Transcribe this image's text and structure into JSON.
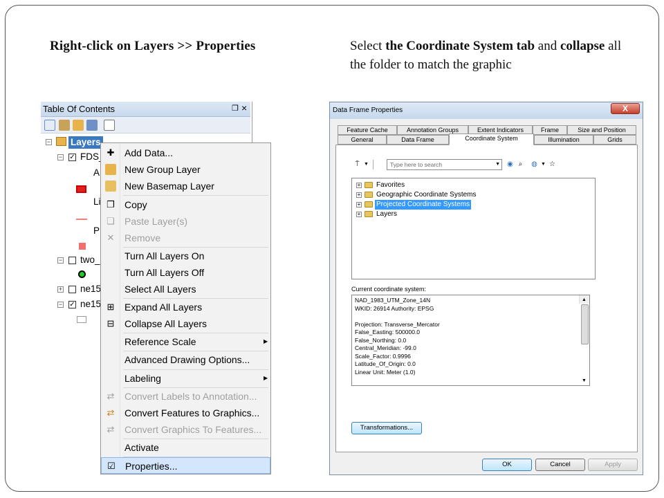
{
  "captions": {
    "left": "Right-click on Layers >> Properties",
    "right_parts": [
      "Select ",
      "the Coordinate System tab",
      " and ",
      "collapse",
      " all the folder to match the graphic"
    ]
  },
  "toc": {
    "title": "Table Of Contents",
    "pin": "❒",
    "close": "×",
    "tree": {
      "layers_label": "Layers",
      "row_fds": "FDS_",
      "row_a": "A",
      "row_li": "Li",
      "row_p": "P",
      "row_two": "two_",
      "row_ne1": "ne15",
      "row_ne2": "ne15"
    },
    "menu": [
      {
        "label": "Add Data...",
        "icon": "add-data-icon",
        "disabled": false
      },
      {
        "label": "New Group Layer",
        "icon": "group-layer-icon",
        "disabled": false
      },
      {
        "label": "New Basemap Layer",
        "icon": "basemap-layer-icon",
        "disabled": false
      },
      {
        "label": "Copy",
        "icon": "copy-icon",
        "disabled": false
      },
      {
        "label": "Paste Layer(s)",
        "icon": "paste-icon",
        "disabled": true
      },
      {
        "label": "Remove",
        "icon": "remove-icon",
        "disabled": true
      },
      {
        "label": "Turn All Layers On",
        "icon": "",
        "disabled": false
      },
      {
        "label": "Turn All Layers Off",
        "icon": "",
        "disabled": false
      },
      {
        "label": "Select All Layers",
        "icon": "",
        "disabled": false
      },
      {
        "label": "Expand All Layers",
        "icon": "expand-icon",
        "disabled": false
      },
      {
        "label": "Collapse All Layers",
        "icon": "collapse-icon",
        "disabled": false
      },
      {
        "label": "Reference Scale",
        "icon": "",
        "disabled": false,
        "submenu": true
      },
      {
        "label": "Advanced Drawing Options...",
        "icon": "",
        "disabled": false
      },
      {
        "label": "Labeling",
        "icon": "",
        "disabled": false,
        "submenu": true
      },
      {
        "label": "Convert Labels to Annotation...",
        "icon": "convert-labels-icon",
        "disabled": true
      },
      {
        "label": "Convert Features to Graphics...",
        "icon": "convert-features-icon",
        "disabled": false
      },
      {
        "label": "Convert Graphics To Features...",
        "icon": "convert-graphics-icon",
        "disabled": true
      },
      {
        "label": "Activate",
        "icon": "",
        "disabled": false
      },
      {
        "label": "Properties...",
        "icon": "properties-icon",
        "disabled": false,
        "highlighted": true
      }
    ]
  },
  "dfp": {
    "title": "Data Frame Properties",
    "close": "X",
    "tabs_row1": [
      "Feature Cache",
      "Annotation Groups",
      "Extent Indicators",
      "Frame",
      "Size and Position"
    ],
    "tabs_row2": [
      "General",
      "Data Frame",
      "Coordinate System",
      "Illumination",
      "Grids"
    ],
    "active_tab": "Coordinate System",
    "search_placeholder": "Type here to search",
    "tree": [
      "Favorites",
      "Geographic Coordinate Systems",
      "Projected Coordinate Systems",
      "Layers"
    ],
    "selected_folder": "Projected Coordinate Systems",
    "current_label": "Current coordinate system:",
    "details": [
      "NAD_1983_UTM_Zone_14N",
      "WKID: 26914 Authority: EPSG",
      "",
      "Projection: Transverse_Mercator",
      "False_Easting: 500000.0",
      "False_Northing: 0.0",
      "Central_Meridian: -99.0",
      "Scale_Factor: 0.9996",
      "Latitude_Of_Origin: 0.0",
      "Linear Unit: Meter (1.0)"
    ],
    "transformations": "Transformations...",
    "ok": "OK",
    "cancel": "Cancel",
    "apply": "Apply"
  },
  "colors": {
    "selection_blue": "#3a78c2",
    "menu_highlight": "#d4e6fb",
    "folder_yellow": "#e8c65e"
  }
}
